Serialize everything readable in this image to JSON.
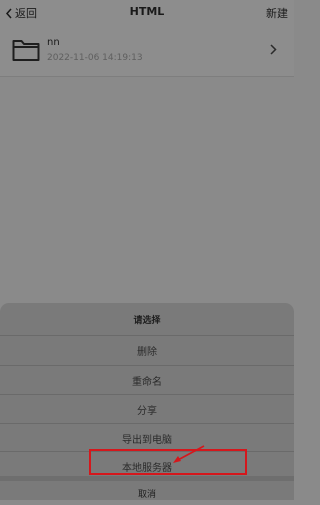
{
  "navbar": {
    "back_label": "返回",
    "title": "HTML",
    "new_label": "新建"
  },
  "file": {
    "name": "nn",
    "date": "2022-11-06 14:19:13",
    "icon": "folder-icon"
  },
  "action_sheet": {
    "title": "请选择",
    "options": [
      {
        "label": "删除"
      },
      {
        "label": "重命名"
      },
      {
        "label": "分享"
      },
      {
        "label": "导出到电脑"
      },
      {
        "label": "本地服务器"
      }
    ],
    "cancel_label": "取消"
  },
  "annotation": {
    "highlight_color": "#d5171c",
    "highlighted_option": "本地服务器"
  }
}
